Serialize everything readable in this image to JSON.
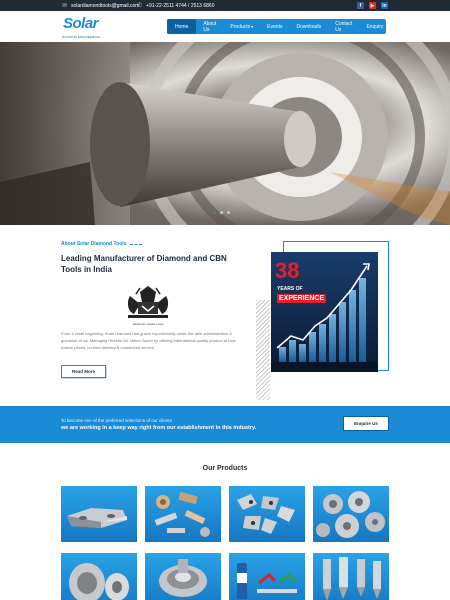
{
  "topbar": {
    "email": "solardiamondtools@gmail.com",
    "phone": "+91-22-2511 4744 / 2513 6860",
    "email_icon": "mail-icon",
    "phone_icon": "phone-icon",
    "social": [
      {
        "name": "facebook-icon",
        "glyph": "f"
      },
      {
        "name": "youtube-icon",
        "glyph": "▶"
      },
      {
        "name": "linkedin-icon",
        "glyph": "in"
      }
    ]
  },
  "header": {
    "logo_word": "Solar",
    "logo_tag": "DIAMOND ENGINEERING",
    "nav": [
      {
        "label": "Home",
        "active": true
      },
      {
        "label": "About Us"
      },
      {
        "label": "Products",
        "dropdown": true
      },
      {
        "label": "Events"
      },
      {
        "label": "Downloads"
      },
      {
        "label": "Contact Us"
      },
      {
        "label": "Enquiry"
      }
    ]
  },
  "hero": {
    "slides": 3,
    "active_slide": 1
  },
  "about": {
    "kicker": "About Solar Diamond Tools",
    "title": "Leading Manufacturer of Diamond and CBN Tools in India",
    "emblem_caption": "Satyamev Jayate Lowe",
    "text": "From a small beginning, Solar Diamond had grown exponentially under the able administration & guidance of our Managing Director Mr. Milind Zaveri by offering international quality product at rock bottom prices, on-time delivery & unmatched service.",
    "read_more": "Read More"
  },
  "experience": {
    "number": "38",
    "line1": "YEARS OF",
    "line2": "EXPERIENCE"
  },
  "cta": {
    "line1": "To become one of the preferred selections of our clients",
    "line2": "we are working in a keep way right from our establishment in this industry.",
    "button": "Enquire Us"
  },
  "products": {
    "title": "Our Products"
  },
  "colors": {
    "accent": "#1b8bd6",
    "dark": "#1f2a35",
    "red": "#e41e2b"
  }
}
